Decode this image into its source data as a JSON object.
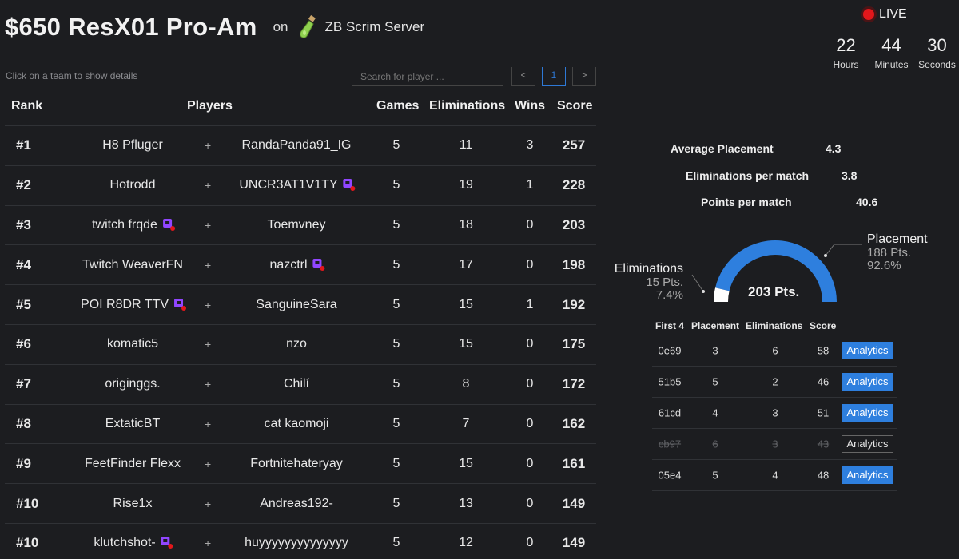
{
  "header": {
    "title": "$650 ResX01 Pro-Am",
    "on": "on",
    "server": "ZB Scrim Server"
  },
  "live": {
    "label": "LIVE",
    "countdown": [
      {
        "value": "22",
        "label": "Hours"
      },
      {
        "value": "44",
        "label": "Minutes"
      },
      {
        "value": "30",
        "label": "Seconds"
      }
    ]
  },
  "leaderboard": {
    "hint": "Click on a team to show details",
    "search_placeholder": "Search for player ...",
    "pagination": {
      "prev": "<",
      "current": "1",
      "next": ">"
    },
    "columns": {
      "rank": "Rank",
      "players": "Players",
      "games": "Games",
      "eliminations": "Eliminations",
      "wins": "Wins",
      "score": "Score"
    },
    "rows": [
      {
        "rank": "#1",
        "p1": "H8 Pfluger",
        "p1_twitch": false,
        "plus": "+",
        "p2": "RandaPanda91_IG",
        "p2_twitch": false,
        "games": "5",
        "elims": "11",
        "wins": "3",
        "score": "257"
      },
      {
        "rank": "#2",
        "p1": "Hotrodd",
        "p1_twitch": false,
        "plus": "+",
        "p2": "UNCR3AT1V1TY",
        "p2_twitch": true,
        "games": "5",
        "elims": "19",
        "wins": "1",
        "score": "228"
      },
      {
        "rank": "#3",
        "p1": "twitch frqde",
        "p1_twitch": true,
        "plus": "+",
        "p2": "Toemvney",
        "p2_twitch": false,
        "games": "5",
        "elims": "18",
        "wins": "0",
        "score": "203"
      },
      {
        "rank": "#4",
        "p1": "Twitch WeaverFN",
        "p1_twitch": false,
        "plus": "+",
        "p2": "nazctrl",
        "p2_twitch": true,
        "games": "5",
        "elims": "17",
        "wins": "0",
        "score": "198"
      },
      {
        "rank": "#5",
        "p1": "POI R8DR TTV",
        "p1_twitch": true,
        "plus": "+",
        "p2": "SanguineSara",
        "p2_twitch": false,
        "games": "5",
        "elims": "15",
        "wins": "1",
        "score": "192"
      },
      {
        "rank": "#6",
        "p1": "komatic5",
        "p1_twitch": false,
        "plus": "+",
        "p2": "nzo",
        "p2_twitch": false,
        "games": "5",
        "elims": "15",
        "wins": "0",
        "score": "175"
      },
      {
        "rank": "#7",
        "p1": "originggs.",
        "p1_twitch": false,
        "plus": "+",
        "p2": "Chilí",
        "p2_twitch": false,
        "games": "5",
        "elims": "8",
        "wins": "0",
        "score": "172"
      },
      {
        "rank": "#8",
        "p1": "ExtaticBT",
        "p1_twitch": false,
        "plus": "+",
        "p2": "cat kaomoji",
        "p2_twitch": false,
        "games": "5",
        "elims": "7",
        "wins": "0",
        "score": "162"
      },
      {
        "rank": "#9",
        "p1": "FeetFinder Flexx",
        "p1_twitch": false,
        "plus": "+",
        "p2": "Fortnitehateryay",
        "p2_twitch": false,
        "games": "5",
        "elims": "15",
        "wins": "0",
        "score": "161"
      },
      {
        "rank": "#10",
        "p1": "Rise1x",
        "p1_twitch": false,
        "plus": "+",
        "p2": "Andreas192-",
        "p2_twitch": false,
        "games": "5",
        "elims": "13",
        "wins": "0",
        "score": "149"
      },
      {
        "rank": "#10",
        "p1": "klutchshot-",
        "p1_twitch": true,
        "plus": "+",
        "p2": "huyyyyyyyyyyyyyy",
        "p2_twitch": false,
        "games": "5",
        "elims": "12",
        "wins": "0",
        "score": "149"
      }
    ]
  },
  "details": {
    "stats": [
      {
        "label": "Average Placement",
        "value": "4.3"
      },
      {
        "label": "Eliminations per match",
        "value": "3.8"
      },
      {
        "label": "Points per match",
        "value": "40.6"
      }
    ],
    "gauge": {
      "total": "203 Pts.",
      "eliminations": {
        "label": "Eliminations",
        "points": "15 Pts.",
        "percent_text": "7.4%",
        "percent": 7.4
      },
      "placement": {
        "label": "Placement",
        "points": "188 Pts.",
        "percent_text": "92.6%",
        "percent": 92.6
      },
      "placement_color": "#2e7fde",
      "eliminations_color": "#ffffff"
    },
    "matches": {
      "columns": {
        "id": "First 4",
        "placement": "Placement",
        "eliminations": "Eliminations",
        "score": "Score"
      },
      "rows": [
        {
          "id": "0e69",
          "placement": "3",
          "eliminations": "6",
          "score": "58",
          "action": "Analytics",
          "dropped": false
        },
        {
          "id": "51b5",
          "placement": "5",
          "eliminations": "2",
          "score": "46",
          "action": "Analytics",
          "dropped": false
        },
        {
          "id": "61cd",
          "placement": "4",
          "eliminations": "3",
          "score": "51",
          "action": "Analytics",
          "dropped": false
        },
        {
          "id": "cb97",
          "placement": "6",
          "eliminations": "3",
          "score": "43",
          "action": "Analytics",
          "dropped": true
        },
        {
          "id": "05e4",
          "placement": "5",
          "eliminations": "4",
          "score": "48",
          "action": "Analytics",
          "dropped": false
        }
      ]
    }
  }
}
